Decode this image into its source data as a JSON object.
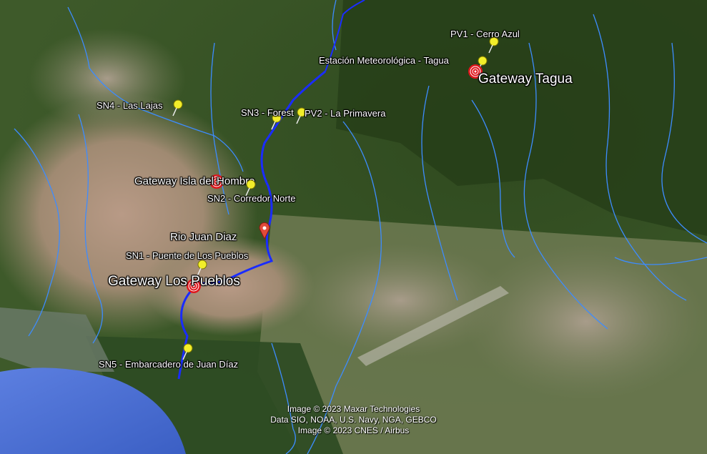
{
  "labels": {
    "pv1": "PV1 - Cerro Azul",
    "estacion": "Estación Meteorológica - Tagua",
    "gw_tagua": "Gateway Tagua",
    "sn4": "SN4 - Las Lajas",
    "sn3": "SN3 - Forest",
    "pv2": "PV2 - La Primavera",
    "gw_isla": "Gateway Isla del Hombre",
    "sn2": "SN2 - Corredor Norte",
    "rio": "Rio Juan Diaz",
    "sn1": "SN1 - Puente de Los Pueblos",
    "gw_pueblos": "Gateway Los Pueblos",
    "sn5": "SN5 - Embarcadero de Juan Díaz"
  },
  "attribution": {
    "line1": "Image © 2023 Maxar Technologies",
    "line2": "Data SIO, NOAA, U.S. Navy, NGA, GEBCO",
    "line3": "Image © 2023 CNES / Airbus"
  },
  "icons": {
    "sensor": "yellow-pushpin-icon",
    "gateway": "red-target-icon",
    "river_marker": "red-location-pin-icon"
  },
  "colors": {
    "river": "#1a2cff",
    "streams": "#3d8cff",
    "sea": "#4f6fd6",
    "pin": "#f2ee2a",
    "gateway": "#e0161c"
  }
}
